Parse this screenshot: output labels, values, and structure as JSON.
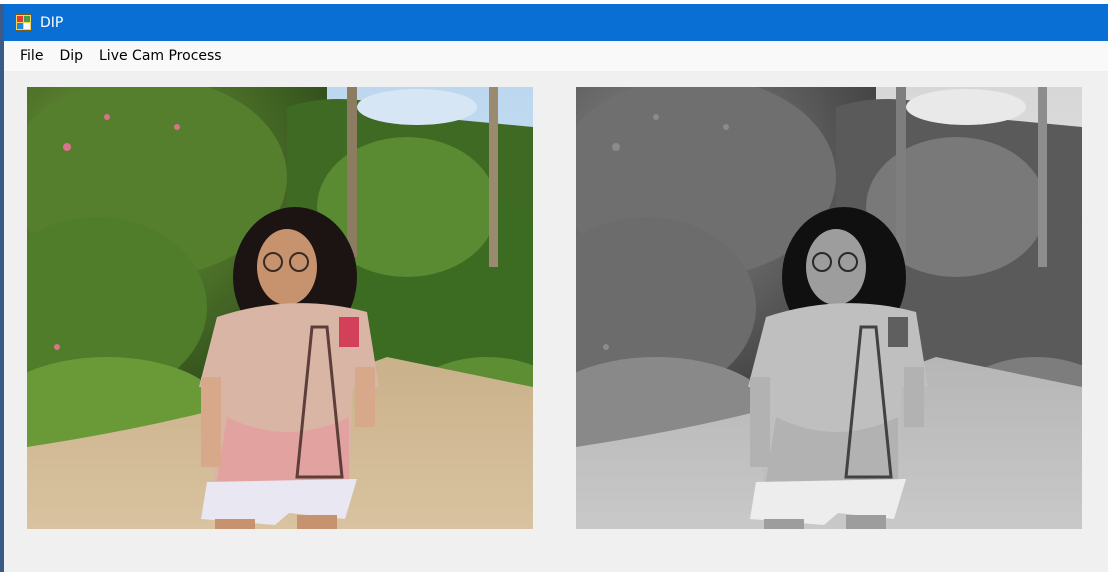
{
  "window": {
    "title": "DIP",
    "title_bar_color": "#0a6fd4"
  },
  "menu": {
    "items": [
      {
        "label": "File"
      },
      {
        "label": "Dip"
      },
      {
        "label": "Live Cam Process"
      }
    ]
  },
  "images": {
    "original": {
      "icon": "photo-color"
    },
    "processed": {
      "icon": "photo-grayscale"
    }
  }
}
